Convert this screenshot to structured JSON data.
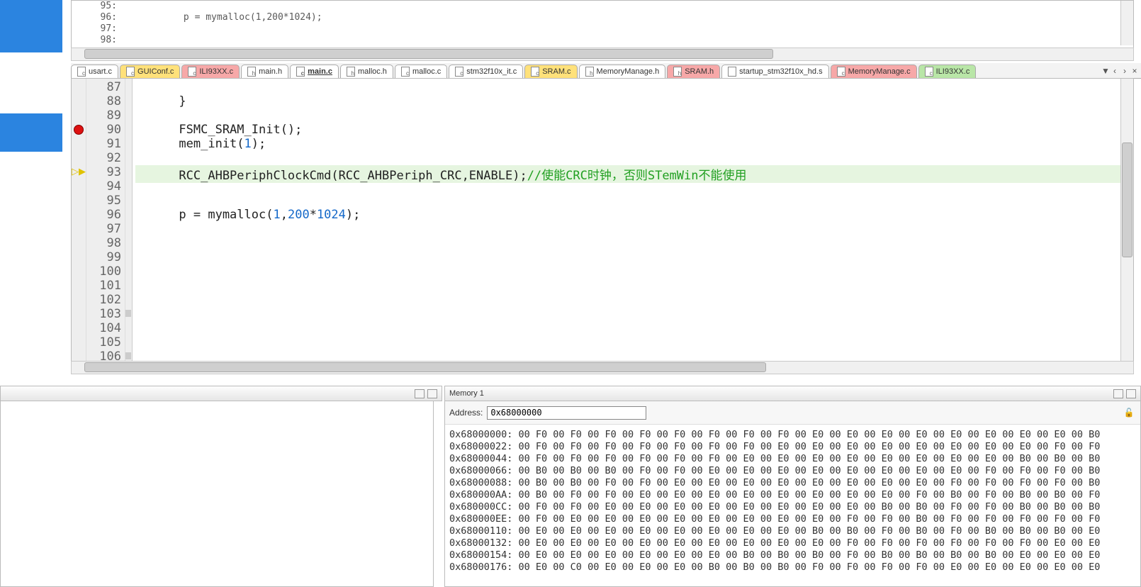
{
  "sidebar": {},
  "topcode": {
    "l95n": "95:",
    "l95c": "",
    "l96n": "96:",
    "l96c": "           p = mymalloc(1,200*1024);",
    "l97n": "97:",
    "l97c": "",
    "l98n": "98:",
    "l98c": ""
  },
  "tabs": [
    {
      "label": "usart.c",
      "cls": "white"
    },
    {
      "label": "GUIConf.c",
      "cls": "yellow"
    },
    {
      "label": "ILI93XX.c",
      "cls": "red"
    },
    {
      "label": "main.h",
      "cls": "white"
    },
    {
      "label": "main.c",
      "cls": "active"
    },
    {
      "label": "malloc.h",
      "cls": "white"
    },
    {
      "label": "malloc.c",
      "cls": "white"
    },
    {
      "label": "stm32f10x_it.c",
      "cls": "white"
    },
    {
      "label": "SRAM.c",
      "cls": "yellow"
    },
    {
      "label": "MemoryManage.h",
      "cls": "white"
    },
    {
      "label": "SRAM.h",
      "cls": "red"
    },
    {
      "label": "startup_stm32f10x_hd.s",
      "cls": "white"
    },
    {
      "label": "MemoryManage.c",
      "cls": "red"
    },
    {
      "label": "ILI93XX.c",
      "cls": "green"
    }
  ],
  "tabctrl": {
    "down": "▼",
    "left": "‹",
    "right": "›",
    "close": "×"
  },
  "editor": {
    "lines": [
      {
        "n": "87",
        "code": ""
      },
      {
        "n": "88",
        "code": "      }"
      },
      {
        "n": "89",
        "code": ""
      },
      {
        "n": "90",
        "code": "      FSMC_SRAM_Init();",
        "bp": true
      },
      {
        "n": "91",
        "code": "      mem_init(1);",
        "num1": "1"
      },
      {
        "n": "92",
        "code": ""
      },
      {
        "n": "93",
        "code": "      RCC_AHBPeriphClockCmd(RCC_AHBPeriph_CRC,ENABLE);",
        "comment": "//使能CRC时钟，否则STemWin不能使用",
        "pc": true,
        "hl": true
      },
      {
        "n": "94",
        "code": ""
      },
      {
        "n": "95",
        "code": ""
      },
      {
        "n": "96",
        "code": "      p = mymalloc(1,200*1024);",
        "num_a": "1",
        "num_b": "200",
        "num_c": "1024"
      },
      {
        "n": "97",
        "code": ""
      },
      {
        "n": "98",
        "code": ""
      },
      {
        "n": "99",
        "code": ""
      },
      {
        "n": "100",
        "code": ""
      },
      {
        "n": "101",
        "code": ""
      },
      {
        "n": "102",
        "code": ""
      },
      {
        "n": "103",
        "code": "",
        "fmark": true
      },
      {
        "n": "104",
        "code": ""
      },
      {
        "n": "105",
        "code": ""
      },
      {
        "n": "106",
        "code": "",
        "fmark": true
      }
    ]
  },
  "memory": {
    "title": "Memory 1",
    "addr_label": "Address:",
    "addr_value": "0x68000000",
    "rows": [
      "0x68000000: 00 F0 00 F0 00 F0 00 F0 00 F0 00 F0 00 F0 00 F0 00 E0 00 E0 00 E0 00 E0 00 E0 00 E0 00 E0 00 E0 00 B0",
      "0x68000022: 00 F0 00 F0 00 F0 00 F0 00 F0 00 F0 00 F0 00 E0 00 E0 00 E0 00 E0 00 E0 00 E0 00 E0 00 E0 00 F0 00 F0",
      "0x68000044: 00 F0 00 F0 00 F0 00 F0 00 F0 00 F0 00 E0 00 E0 00 E0 00 E0 00 E0 00 E0 00 E0 00 E0 00 B0 00 B0 00 B0",
      "0x68000066: 00 B0 00 B0 00 B0 00 F0 00 F0 00 E0 00 E0 00 E0 00 E0 00 E0 00 E0 00 E0 00 E0 00 F0 00 F0 00 F0 00 B0",
      "0x68000088: 00 B0 00 B0 00 F0 00 F0 00 E0 00 E0 00 E0 00 E0 00 E0 00 E0 00 E0 00 E0 00 F0 00 F0 00 F0 00 F0 00 B0",
      "0x680000AA: 00 B0 00 F0 00 F0 00 E0 00 E0 00 E0 00 E0 00 E0 00 E0 00 E0 00 E0 00 F0 00 B0 00 F0 00 B0 00 B0 00 F0",
      "0x680000CC: 00 F0 00 F0 00 E0 00 E0 00 E0 00 E0 00 E0 00 E0 00 E0 00 E0 00 B0 00 B0 00 F0 00 F0 00 B0 00 B0 00 B0",
      "0x680000EE: 00 F0 00 E0 00 E0 00 E0 00 E0 00 E0 00 E0 00 E0 00 E0 00 F0 00 F0 00 B0 00 F0 00 F0 00 F0 00 F0 00 F0",
      "0x68000110: 00 E0 00 E0 00 E0 00 E0 00 E0 00 E0 00 E0 00 E0 00 B0 00 B0 00 F0 00 B0 00 F0 00 B0 00 B0 00 B0 00 E0",
      "0x68000132: 00 E0 00 E0 00 E0 00 E0 00 E0 00 E0 00 E0 00 E0 00 E0 00 F0 00 F0 00 F0 00 F0 00 F0 00 F0 00 E0 00 E0",
      "0x68000154: 00 E0 00 E0 00 E0 00 E0 00 E0 00 E0 00 B0 00 B0 00 B0 00 F0 00 B0 00 B0 00 B0 00 B0 00 E0 00 E0 00 E0",
      "0x68000176: 00 E0 00 C0 00 E0 00 E0 00 E0 00 B0 00 B0 00 B0 00 F0 00 F0 00 F0 00 F0 00 E0 00 E0 00 E0 00 E0 00 E0"
    ]
  }
}
